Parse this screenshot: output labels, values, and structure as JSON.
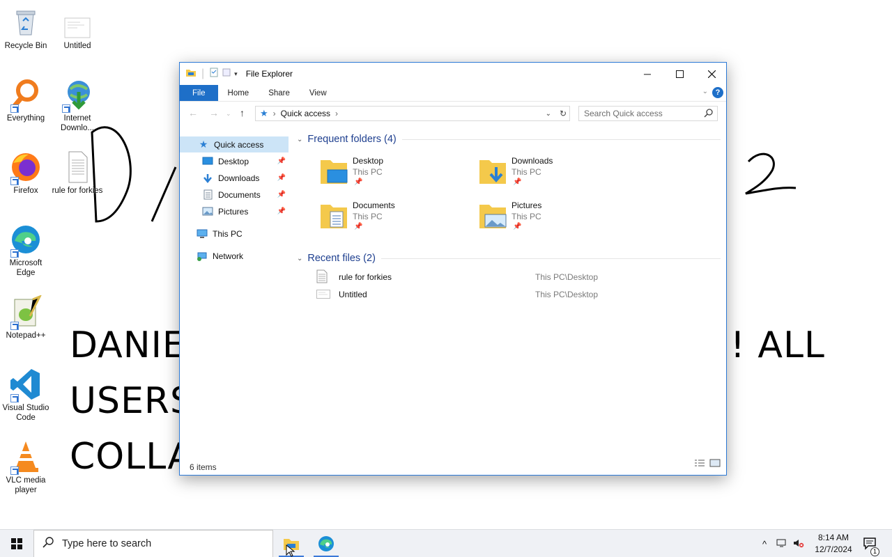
{
  "desktop": {
    "icons": [
      {
        "label": "Recycle Bin"
      },
      {
        "label": "Untitled"
      },
      {
        "label": "Everything"
      },
      {
        "label": "Internet Downlo..."
      },
      {
        "label": "Firefox"
      },
      {
        "label": "rule for forkies"
      },
      {
        "label": "Microsoft Edge"
      },
      {
        "label": "Notepad++"
      },
      {
        "label": "Visual Studio Code"
      },
      {
        "label": "VLC media player"
      }
    ],
    "wallpaper_text": [
      "DANIE",
      "USERS",
      "COLLA",
      "! ALL"
    ]
  },
  "explorer": {
    "title": "File Explorer",
    "tabs": {
      "file": "File",
      "home": "Home",
      "share": "Share",
      "view": "View"
    },
    "help": "?",
    "address": {
      "current": "Quick access",
      "separator": "›"
    },
    "search_placeholder": "Search Quick access",
    "nav": {
      "quick_access": "Quick access",
      "pinned": [
        {
          "label": "Desktop"
        },
        {
          "label": "Downloads"
        },
        {
          "label": "Documents"
        },
        {
          "label": "Pictures"
        }
      ],
      "this_pc": "This PC",
      "network": "Network"
    },
    "frequent": {
      "header": "Frequent folders (4)",
      "folders": [
        {
          "name": "Desktop",
          "location": "This PC"
        },
        {
          "name": "Downloads",
          "location": "This PC"
        },
        {
          "name": "Documents",
          "location": "This PC"
        },
        {
          "name": "Pictures",
          "location": "This PC"
        }
      ]
    },
    "recent": {
      "header": "Recent files (2)",
      "files": [
        {
          "name": "rule for forkies",
          "path": "This PC\\Desktop"
        },
        {
          "name": "Untitled",
          "path": "This PC\\Desktop"
        }
      ]
    },
    "status": "6 items"
  },
  "taskbar": {
    "search_placeholder": "Type here to search",
    "time": "8:14 AM",
    "date": "12/7/2024",
    "notification_count": "1"
  },
  "colors": {
    "accent": "#1e6fc8",
    "selected": "#cce4f7",
    "folder": "#f4c94b"
  }
}
